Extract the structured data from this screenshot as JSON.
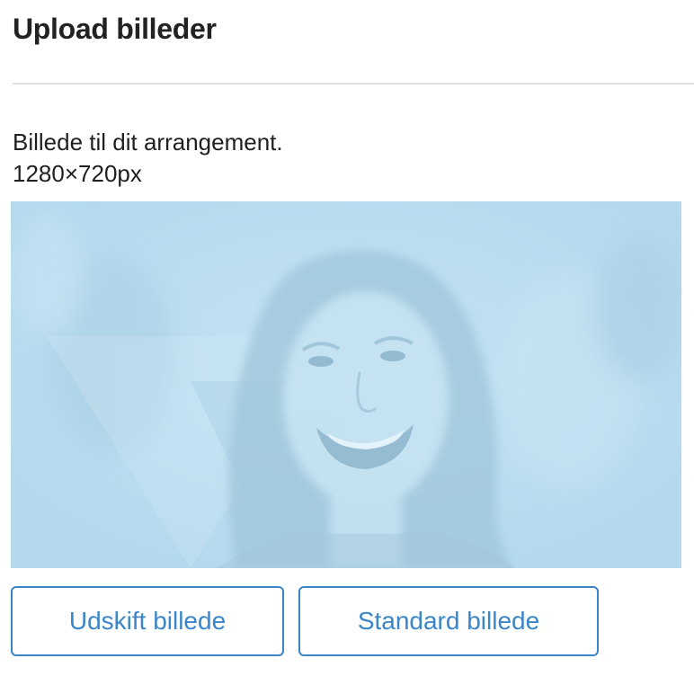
{
  "header": {
    "title": "Upload billeder"
  },
  "description": {
    "line1": "Billede til dit arrangement.",
    "line2": "1280×720px"
  },
  "image": {
    "alt": "Smilende kvinde",
    "overlay_color": "#b8dcef"
  },
  "buttons": {
    "replace_label": "Udskift billede",
    "default_label": "Standard billede"
  },
  "colors": {
    "accent": "#3a86c8",
    "text": "#222222",
    "divider": "#e2e2e2"
  }
}
